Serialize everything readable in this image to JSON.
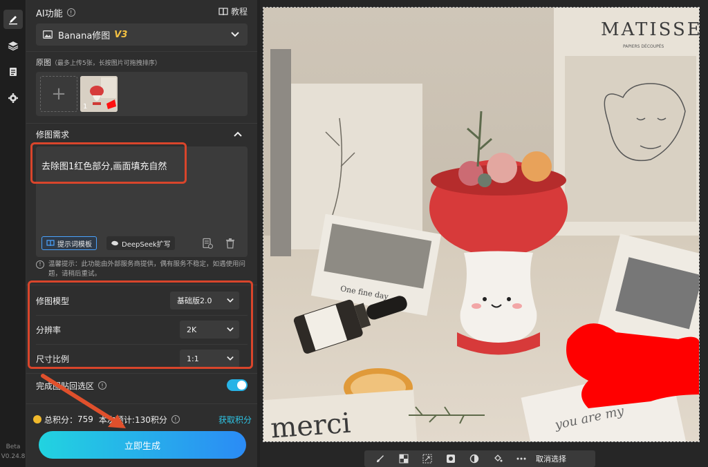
{
  "panel": {
    "title": "AI功能",
    "tutorial_label": "教程",
    "model": {
      "name": "Banana修图",
      "version": "V3"
    },
    "original": {
      "label": "原图",
      "hint": "（最多上传5张，长按图片可拖拽排序）",
      "thumb_index": "1",
      "add_symbol": "+"
    },
    "requirement": {
      "label": "修图需求",
      "text": "去除图1红色部分,画面填充自然",
      "prompt_template_label": "提示词模板",
      "deepseek_label": "DeepSeek扩写"
    },
    "notice": "温馨提示：此功能由外部服务商提供，偶有服务不稳定，如遇使用问题，请稍后重试。",
    "settings": [
      {
        "label": "修图模型",
        "value": "基础版2.0"
      },
      {
        "label": "分辨率",
        "value": "2K"
      },
      {
        "label": "尺寸比例",
        "value": "1:1"
      }
    ],
    "paste_back": {
      "label": "完成图贴回选区",
      "enabled": true
    },
    "points": {
      "total_label": "总积分：",
      "total_value": "759",
      "estimate_label": "本次预计:130积分",
      "get_points_label": "获取积分"
    },
    "generate_label": "立即生成"
  },
  "rail": {
    "beta": "Beta",
    "version": "V0.24.8"
  },
  "toolbar": {
    "deselect_label": "取消选择"
  },
  "photo": {
    "matisse_title": "MATISSE",
    "matisse_sub": "PAPIERS DÉCOUPÉS",
    "card_text": "One fine day",
    "merci": "merci",
    "note_text": "you are my"
  },
  "colors": {
    "accent": "#27b3e6",
    "highlight": "#d9452b",
    "version_gold": "#f5c242",
    "mask_red": "#ff0000"
  }
}
